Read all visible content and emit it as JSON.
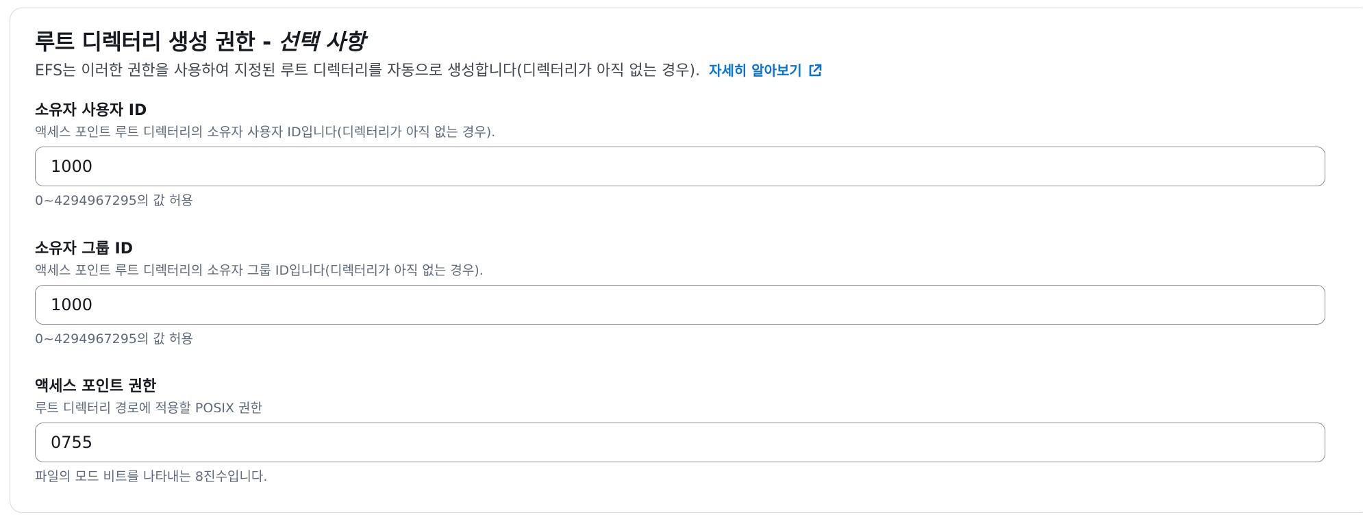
{
  "section": {
    "title": "루트 디렉터리 생성 권한 - ",
    "title_optional": "선택 사항",
    "description": "EFS는 이러한 권한을 사용하여 지정된 루트 디렉터리를 자동으로 생성합니다(디렉터리가 아직 없는 경우).",
    "learn_more_label": "자세히 알아보기",
    "learn_more_icon": "external-link-icon",
    "link_color": "#0972d3"
  },
  "fields": {
    "owner_user_id": {
      "label": "소유자 사용자 ID",
      "description": "액세스 포인트 루트 디렉터리의 소유자 사용자 ID입니다(디렉터리가 아직 없는 경우).",
      "value": "1000",
      "constraint": "0~4294967295의 값 허용"
    },
    "owner_group_id": {
      "label": "소유자 그룹 ID",
      "description": "액세스 포인트 루트 디렉터리의 소유자 그룹 ID입니다(디렉터리가 아직 없는 경우).",
      "value": "1000",
      "constraint": "0~4294967295의 값 허용"
    },
    "access_point_permissions": {
      "label": "액세스 포인트 권한",
      "description": "루트 디렉터리 경로에 적용할 POSIX 권한",
      "value": "0755",
      "constraint": "파일의 모드 비트를 나타내는 8진수입니다."
    }
  }
}
